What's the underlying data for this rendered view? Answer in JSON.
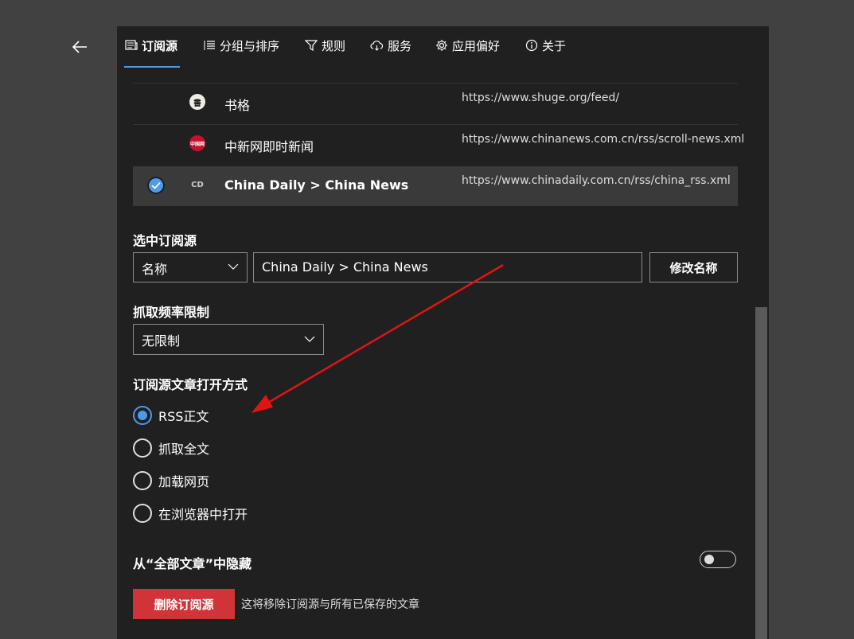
{
  "tabs": [
    {
      "label": "订阅源",
      "icon": "feed-icon",
      "active": true
    },
    {
      "label": "分组与排序",
      "icon": "list-icon",
      "active": false
    },
    {
      "label": "规则",
      "icon": "filter-icon",
      "active": false
    },
    {
      "label": "服务",
      "icon": "cloud-icon",
      "active": false
    },
    {
      "label": "应用偏好",
      "icon": "gear-icon",
      "active": false
    },
    {
      "label": "关于",
      "icon": "info-icon",
      "active": false
    }
  ],
  "feeds": [
    {
      "name": "书格",
      "url": "https://www.shuge.org/feed/",
      "favicon_text": "書",
      "selected": false
    },
    {
      "name": "中新网即时新闻",
      "url": "https://www.chinanews.com.cn/rss/scroll-news.xml",
      "favicon_text": "中国网",
      "selected": false
    },
    {
      "name": "China Daily > China News",
      "url": "https://www.chinadaily.com.cn/rss/china_rss.xml",
      "favicon_text": "CD",
      "selected": true
    }
  ],
  "selected_source": {
    "label": "选中订阅源",
    "field_select": "名称",
    "name_value": "China Daily > China News",
    "rename_button": "修改名称"
  },
  "fetch_limit": {
    "label": "抓取频率限制",
    "value": "无限制"
  },
  "open_mode": {
    "label": "订阅源文章打开方式",
    "options": [
      {
        "label": "RSS正文",
        "checked": true
      },
      {
        "label": "抓取全文",
        "checked": false
      },
      {
        "label": "加载网页",
        "checked": false
      },
      {
        "label": "在浏览器中打开",
        "checked": false
      }
    ]
  },
  "hide_toggle": {
    "label": "从“全部文章”中隐藏",
    "on": false
  },
  "delete": {
    "button": "删除订阅源",
    "hint": "这将移除订阅源与所有已保存的文章"
  },
  "colors": {
    "accent": "#4a9bea",
    "danger": "#d13438",
    "annotation_arrow": "#e11414"
  }
}
